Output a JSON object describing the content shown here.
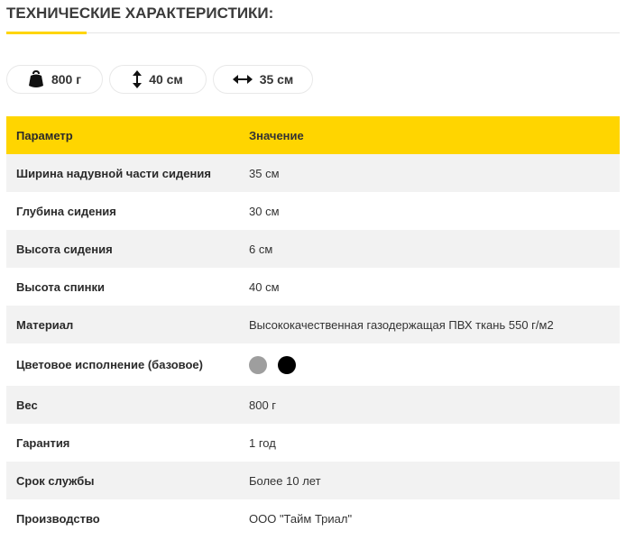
{
  "title": "ТЕХНИЧЕСКИЕ ХАРАКТЕРИСТИКИ:",
  "colors": {
    "accent": "#ffd500",
    "swatch_gray": "#9e9e9e",
    "swatch_black": "#000000"
  },
  "badges": [
    {
      "icon": "weight-icon",
      "label": "800 г"
    },
    {
      "icon": "vertical-arrow-icon",
      "label": "40 см"
    },
    {
      "icon": "horizontal-arrow-icon",
      "label": "35 см"
    }
  ],
  "table": {
    "headers": [
      "Параметр",
      "Значение"
    ],
    "rows": [
      {
        "param": "Ширина надувной части сидения",
        "value": "35 см"
      },
      {
        "param": "Глубина сидения",
        "value": "30 см"
      },
      {
        "param": "Высота сидения",
        "value": "6 см"
      },
      {
        "param": "Высота спинки",
        "value": "40 см"
      },
      {
        "param": "Материал",
        "value": "Высококачественная газодержащая ПВХ ткань 550 г/м2"
      },
      {
        "param": "Цветовое исполнение (базовое)",
        "value": ""
      },
      {
        "param": "Вес",
        "value": "800 г"
      },
      {
        "param": "Гарантия",
        "value": "1 год"
      },
      {
        "param": "Срок службы",
        "value": "Более 10 лет"
      },
      {
        "param": "Производство",
        "value": "ООО \"Тайм Триал\""
      }
    ]
  }
}
